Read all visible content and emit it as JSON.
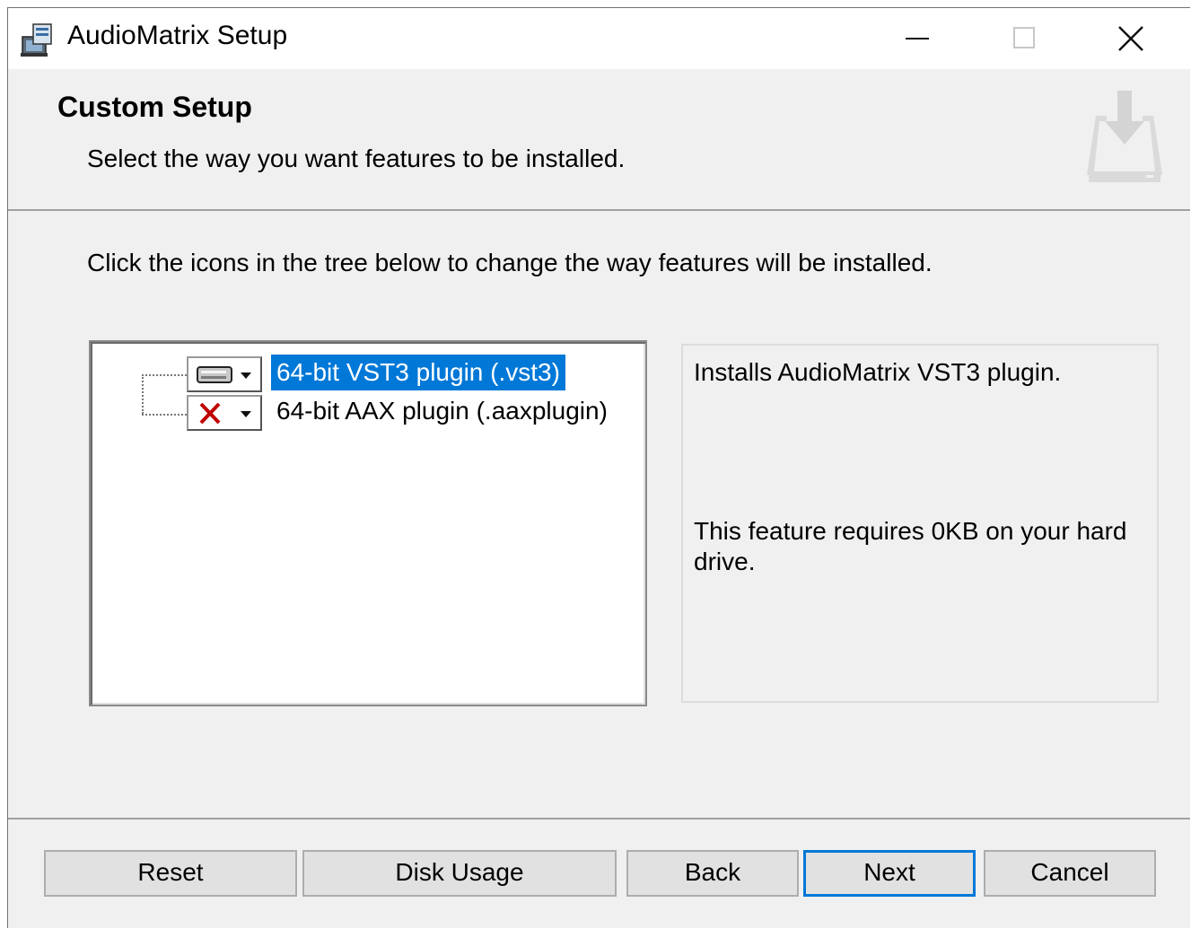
{
  "window": {
    "title": "AudioMatrix Setup",
    "app_icon": "installer-icon",
    "controls": [
      "minimize-icon",
      "maximize-icon",
      "close-icon"
    ]
  },
  "header": {
    "title": "Custom Setup",
    "subtitle": "Select the way you want features to be installed.",
    "icon": "download-drive-icon"
  },
  "instruction": "Click the icons in the tree below to change the way features will be installed.",
  "tree": {
    "items": [
      {
        "label": "64-bit VST3 plugin (.vst3)",
        "state_icon": "hard-drive-icon",
        "selected": true
      },
      {
        "label": "64-bit AAX plugin (.aaxplugin)",
        "state_icon": "red-x-icon",
        "selected": false
      }
    ]
  },
  "description": {
    "text": "Installs AudioMatrix VST3 plugin.",
    "size_text": "This feature requires 0KB on your hard drive."
  },
  "buttons": {
    "reset": "Reset",
    "disk_usage": "Disk Usage",
    "back": "Back",
    "next": "Next",
    "cancel": "Cancel"
  },
  "colors": {
    "selection": "#0078d7",
    "default_button_border": "#0078d7",
    "red_x": "#c00000"
  }
}
